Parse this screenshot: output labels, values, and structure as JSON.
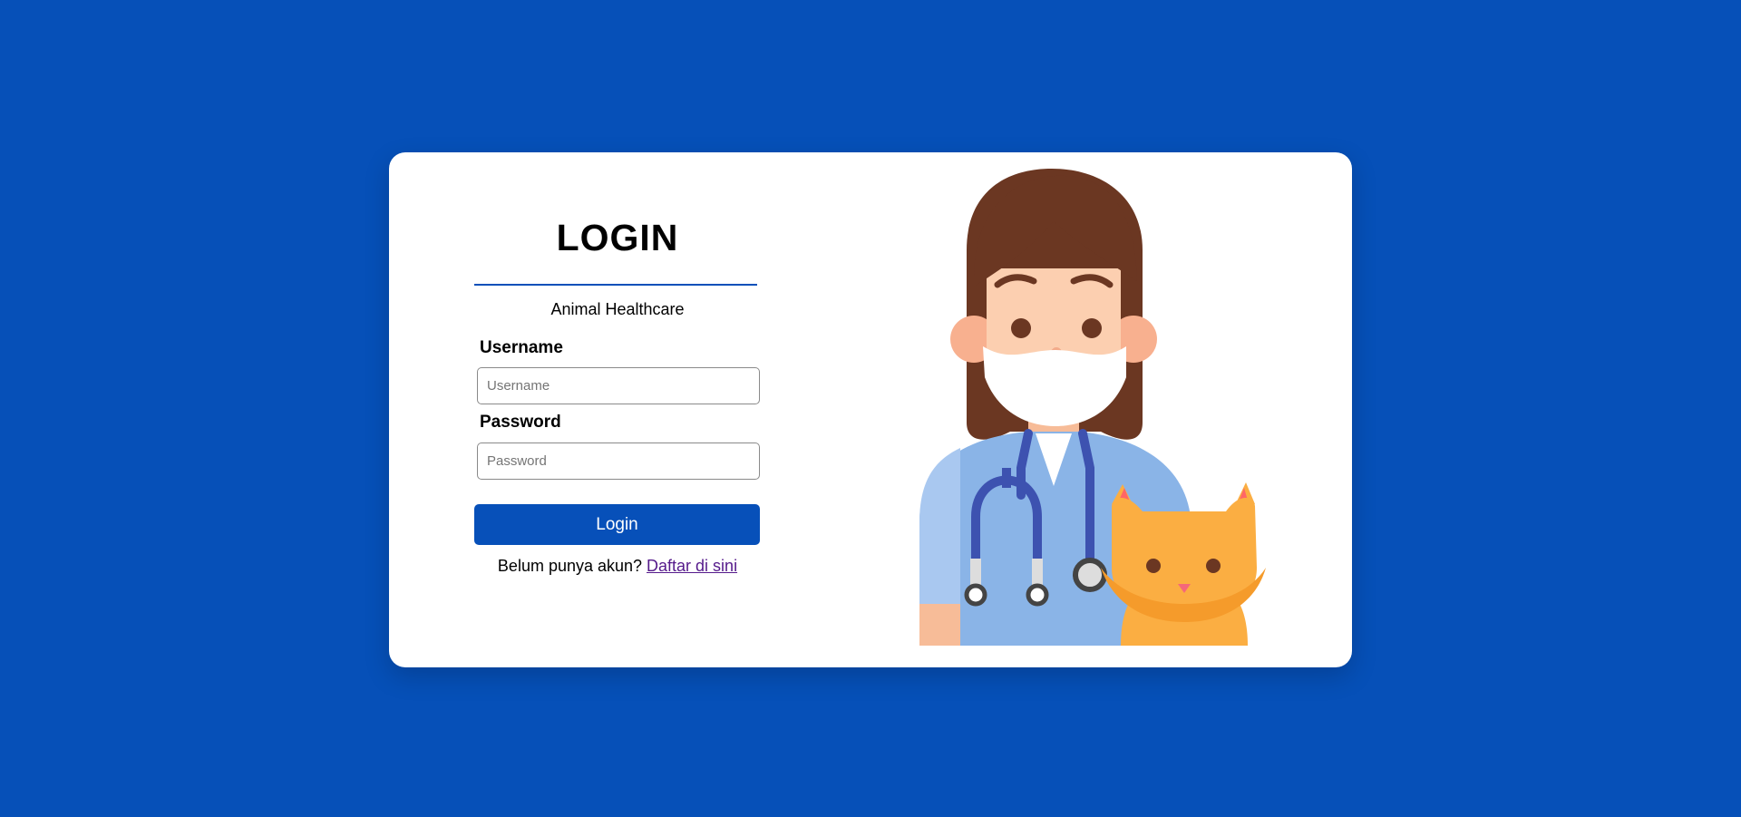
{
  "colors": {
    "page_background": "#0650b8",
    "card_background": "#ffffff",
    "accent": "#0750b9",
    "link": "#551a8b"
  },
  "login_form": {
    "title": "LOGIN",
    "subtitle": "Animal Healthcare",
    "username_label": "Username",
    "username_placeholder": "Username",
    "username_value": "",
    "password_label": "Password",
    "password_placeholder": "Password",
    "password_value": "",
    "login_button_label": "Login",
    "register_prompt": "Belum punya akun? ",
    "register_link_label": "Daftar di sini"
  },
  "illustration": {
    "icon": "veterinarian-with-cat-icon"
  }
}
